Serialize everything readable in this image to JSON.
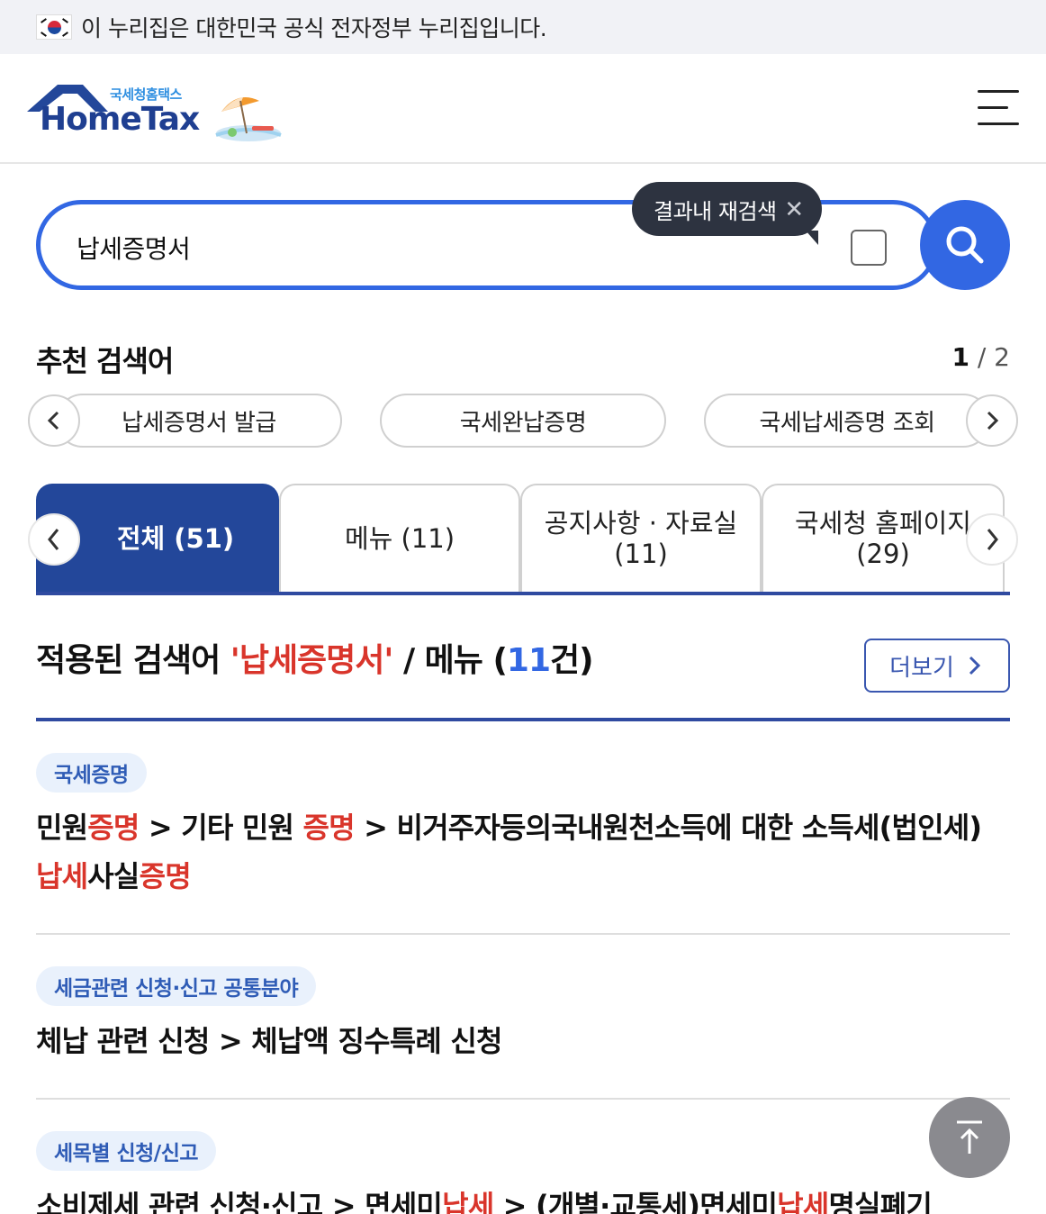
{
  "gov_banner": {
    "text": "이 누리집은 대한민국 공식 전자정부 누리집입니다."
  },
  "header": {
    "logo_small": "국세청홈택스",
    "logo_big": "HomeTax"
  },
  "search": {
    "value": "납세증명서",
    "recheck_tooltip": "결과내 재검색",
    "recheck_close": "✕"
  },
  "recommended": {
    "title": "추천 검색어",
    "page_current": "1",
    "page_sep": " / ",
    "page_total": "2",
    "keywords": [
      "납세증명서 발급",
      "국세완납증명",
      "국세납세증명 조회"
    ]
  },
  "tabs": [
    {
      "label": "전체 (51)",
      "active": true
    },
    {
      "label": "메뉴 (11)",
      "active": false
    },
    {
      "label_line1": "공지사항 · 자료실",
      "label_line2": "(11)",
      "active": false
    },
    {
      "label_line1": "국세청 홈페이지",
      "label_line2": "(29)",
      "active": false
    }
  ],
  "results": {
    "prefix": "적용된 검색어 ",
    "query": "'납세증명서'",
    "middle": " / 메뉴 (",
    "count": "11",
    "suffix": "건)",
    "more": "더보기"
  },
  "items": [
    {
      "tag": "국세증명",
      "segments": [
        [
          "민원",
          false
        ],
        [
          "증명",
          true
        ],
        [
          " > 기타 민원 ",
          false
        ],
        [
          "증명",
          true
        ],
        [
          " > 비거주자등의국내원천소득에 대한 소득세(법인세) ",
          false
        ],
        [
          "납세",
          true
        ],
        [
          "사실",
          false
        ],
        [
          "증명",
          true
        ]
      ]
    },
    {
      "tag": "세금관련 신청·신고 공통분야",
      "segments": [
        [
          "체납 관련 신청 > 체납액 징수특례 신청",
          false
        ]
      ]
    },
    {
      "tag": "세목별 신청/신고",
      "segments": [
        [
          "소비제세 관련 신청·신고 > 면세미",
          false
        ],
        [
          "납세",
          true
        ],
        [
          " > (개별·교통세)면세미",
          false
        ],
        [
          "납세",
          true
        ],
        [
          "명실폐기",
          false
        ]
      ]
    }
  ],
  "colors": {
    "primary": "#3267e3",
    "navy": "#23479a",
    "highlight": "#d9352b",
    "tag_bg": "#e9f1fc"
  }
}
